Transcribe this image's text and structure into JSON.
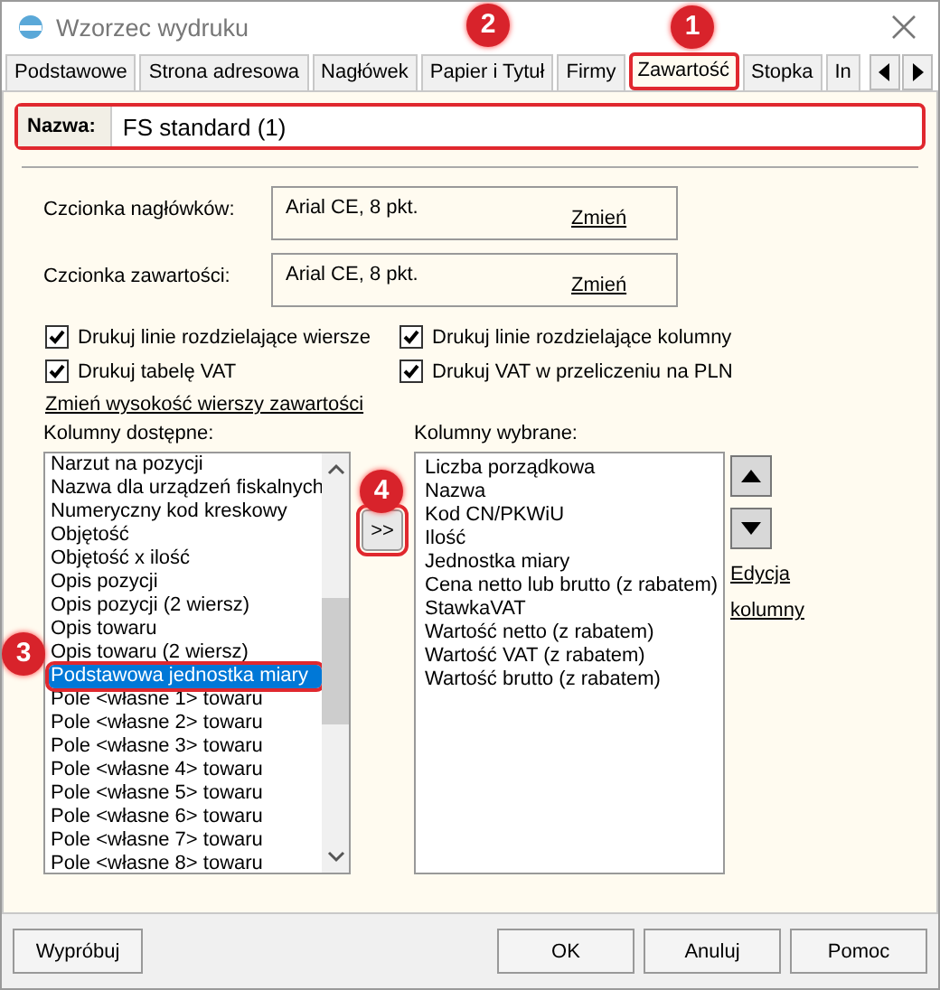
{
  "window": {
    "title": "Wzorzec wydruku"
  },
  "tabs": [
    {
      "label": "Podstawowe",
      "selected": false,
      "highlight": false
    },
    {
      "label": "Strona adresowa",
      "selected": false,
      "highlight": false
    },
    {
      "label": "Nagłówek",
      "selected": false,
      "highlight": false
    },
    {
      "label": "Papier i Tytuł",
      "selected": false,
      "highlight": false
    },
    {
      "label": "Firmy",
      "selected": false,
      "highlight": false
    },
    {
      "label": "Zawartość",
      "selected": true,
      "highlight": true
    },
    {
      "label": "Stopka",
      "selected": false,
      "highlight": false
    },
    {
      "label": "In",
      "selected": false,
      "highlight": false
    }
  ],
  "name_field": {
    "label": "Nazwa:",
    "value": "FS standard (1)",
    "highlight": true
  },
  "fonts": [
    {
      "label": "Czcionka nagłówków:",
      "value": "Arial CE, 8 pkt.",
      "link": "Zmień"
    },
    {
      "label": "Czcionka zawartości:",
      "value": "Arial CE, 8 pkt.",
      "link": "Zmień"
    }
  ],
  "checkboxes": [
    {
      "label": "Drukuj linie rozdzielające wiersze",
      "checked": true
    },
    {
      "label": "Drukuj linie rozdzielające kolumny",
      "checked": true
    },
    {
      "label": "Drukuj tabelę VAT",
      "checked": true
    },
    {
      "label": "Drukuj VAT w przeliczeniu na PLN",
      "checked": true
    }
  ],
  "row_height_link": "Zmień wysokość wierszy zawartości",
  "available": {
    "label": "Kolumny dostępne:",
    "items": [
      {
        "label": "Narzut na pozycji",
        "selected": false,
        "highlight": false
      },
      {
        "label": "Nazwa dla urządzeń fiskalnych",
        "selected": false,
        "highlight": false
      },
      {
        "label": "Numeryczny kod kreskowy",
        "selected": false,
        "highlight": false
      },
      {
        "label": "Objętość",
        "selected": false,
        "highlight": false
      },
      {
        "label": "Objętość x ilość",
        "selected": false,
        "highlight": false
      },
      {
        "label": "Opis pozycji",
        "selected": false,
        "highlight": false
      },
      {
        "label": "Opis pozycji (2 wiersz)",
        "selected": false,
        "highlight": false
      },
      {
        "label": "Opis towaru",
        "selected": false,
        "highlight": false
      },
      {
        "label": "Opis towaru (2 wiersz)",
        "selected": false,
        "highlight": false
      },
      {
        "label": "Podstawowa jednostka miary",
        "selected": true,
        "highlight": true
      },
      {
        "label": "Pole <własne 1> towaru",
        "selected": false,
        "highlight": false
      },
      {
        "label": "Pole <własne 2> towaru",
        "selected": false,
        "highlight": false
      },
      {
        "label": "Pole <własne 3> towaru",
        "selected": false,
        "highlight": false
      },
      {
        "label": "Pole <własne 4> towaru",
        "selected": false,
        "highlight": false
      },
      {
        "label": "Pole <własne 5> towaru",
        "selected": false,
        "highlight": false
      },
      {
        "label": "Pole <własne 6> towaru",
        "selected": false,
        "highlight": false
      },
      {
        "label": "Pole <własne 7> towaru",
        "selected": false,
        "highlight": false
      },
      {
        "label": "Pole <własne 8> towaru",
        "selected": false,
        "highlight": false
      }
    ]
  },
  "move_buttons": [
    {
      "label": ">>",
      "highlight": true
    }
  ],
  "chosen": {
    "label": "Kolumny wybrane:",
    "items": [
      "Liczba porządkowa",
      "Nazwa",
      "Kod CN/PKWiU",
      "Ilość",
      "Jednostka miary",
      "Cena netto lub brutto (z rabatem)",
      "StawkaVAT",
      "Wartość netto (z rabatem)",
      "Wartość VAT (z rabatem)",
      "Wartość brutto (z rabatem)"
    ]
  },
  "edit_link": [
    "Edycja",
    "kolumny"
  ],
  "buttons": [
    {
      "label": "Wypróbuj"
    },
    {
      "label": "OK"
    },
    {
      "label": "Anuluj"
    },
    {
      "label": "Pomoc"
    }
  ],
  "callouts": [
    "1",
    "2",
    "3",
    "4"
  ]
}
